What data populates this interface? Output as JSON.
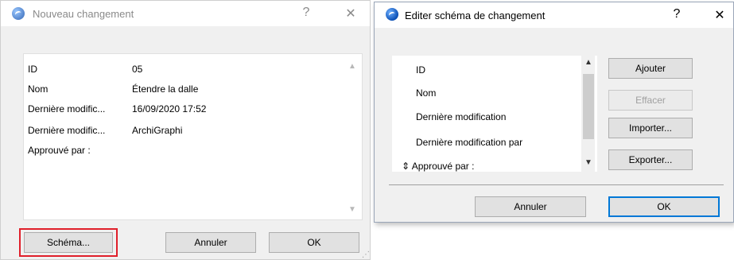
{
  "dialog1": {
    "title": "Nouveau changement",
    "help_glyph": "?",
    "close_glyph": "✕",
    "rows": [
      {
        "key": "ID",
        "value": "05"
      },
      {
        "key": "Nom",
        "value": "Étendre la dalle"
      },
      {
        "key": "Dernière modific...",
        "value": "16/09/2020 17:52"
      },
      {
        "key": "Dernière modific...",
        "value": "ArchiGraphi"
      },
      {
        "key": "Approuvé par :",
        "value": ""
      }
    ],
    "buttons": {
      "schema": "Schéma...",
      "cancel": "Annuler",
      "ok": "OK"
    },
    "scroll_up": "▲",
    "scroll_down": "▼"
  },
  "dialog2": {
    "title": "Editer schéma de changement",
    "help_glyph": "?",
    "close_glyph": "✕",
    "items": [
      "ID",
      "Nom",
      "Dernière modification",
      "Dernière modification par",
      "Approuvé par :"
    ],
    "move_glyph": "⇕",
    "scroll_up": "▲",
    "scroll_down": "▼",
    "buttons": {
      "add": "Ajouter",
      "delete": "Effacer",
      "import": "Importer...",
      "export": "Exporter...",
      "cancel": "Annuler",
      "ok": "OK"
    }
  }
}
